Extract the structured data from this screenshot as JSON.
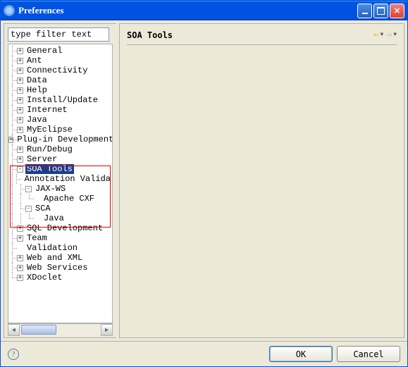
{
  "window": {
    "title": "Preferences"
  },
  "filter": {
    "placeholder": "type filter text"
  },
  "tree": {
    "general": "General",
    "ant": "Ant",
    "connectivity": "Connectivity",
    "data": "Data",
    "help": "Help",
    "install": "Install/Update",
    "internet": "Internet",
    "java": "Java",
    "myeclipse": "MyEclipse",
    "plugin": "Plug-in Development",
    "rundebug": "Run/Debug",
    "server": "Server",
    "soa": "SOA Tools",
    "soa_annot": "Annotation Valida",
    "soa_jaxws": "JAX-WS",
    "soa_cxf": "Apache CXF",
    "soa_sca": "SCA",
    "soa_sca_java": "Java",
    "sqldev": "SQL Development",
    "team": "Team",
    "validation": "Validation",
    "webxml": "Web and XML",
    "webservices": "Web Services",
    "xdoclet": "XDoclet"
  },
  "panel": {
    "title": "SOA Tools"
  },
  "buttons": {
    "ok": "OK",
    "cancel": "Cancel"
  }
}
